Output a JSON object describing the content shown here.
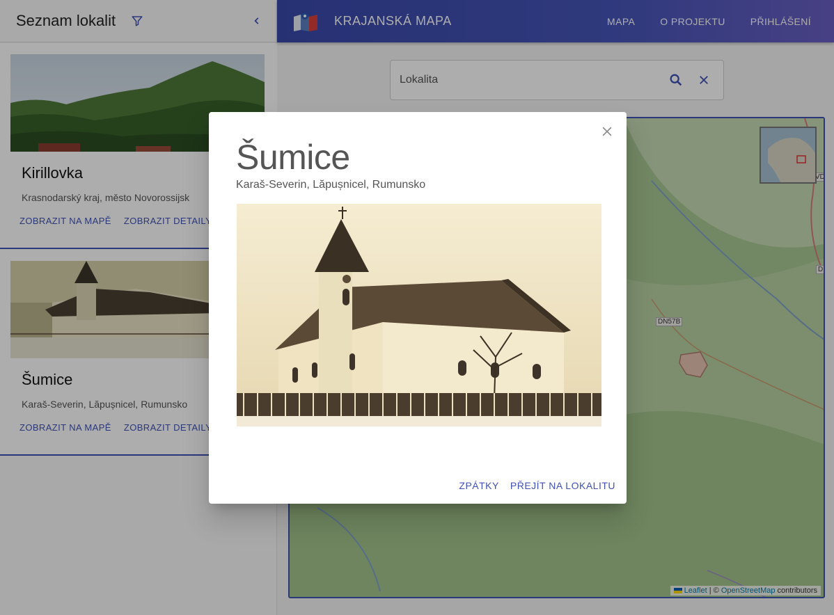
{
  "sidebar": {
    "title": "Seznam lokalit",
    "items": [
      {
        "title": "Kirillovka",
        "subtitle": "Krasnodarský kraj, město Novorossijsk",
        "show_on_map": "ZOBRAZIT NA MAPĚ",
        "show_details": "ZOBRAZIT DETAILY"
      },
      {
        "title": "Šumice",
        "subtitle": "Karaš-Severin, Lăpușnicel, Rumunsko",
        "show_on_map": "ZOBRAZIT NA MAPĚ",
        "show_details": "ZOBRAZIT DETAILY"
      }
    ]
  },
  "header": {
    "brand": "KRAJANSKÁ MAPA",
    "nav": [
      "MAPA",
      "O PROJEKTU",
      "PŘIHLÁŠENÍ"
    ]
  },
  "search": {
    "placeholder": "Lokalita"
  },
  "map": {
    "road_labels": [
      "DN57B",
      "VD",
      "D"
    ],
    "attribution": {
      "leaflet": "Leaflet",
      "separator": " | © ",
      "osm": "OpenStreetMap",
      "suffix": " contributors"
    }
  },
  "dialog": {
    "title": "Šumice",
    "subtitle": "Karaš-Severin, Lăpușnicel, Rumunsko",
    "back": "ZPÁTKY",
    "go": "PŘEJÍT NA LOKALITU"
  },
  "icons": {
    "filter": "filter-icon",
    "collapse": "chevron-left-icon",
    "search": "search-icon",
    "clear": "close-icon",
    "dialog_close": "close-icon"
  },
  "colors": {
    "accent": "#3f51b5",
    "topbar_start": "#3949ab",
    "topbar_end": "#6a5fc4"
  }
}
